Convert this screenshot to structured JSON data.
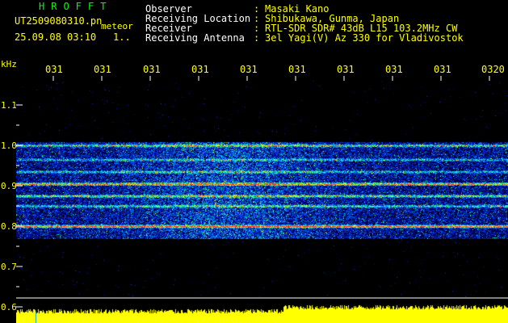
{
  "header": {
    "app_name": "HROFFT",
    "file_name": "UT2509080310.pn",
    "file_kind": "meteor",
    "date_time": "25.09.08 03:10",
    "date_extra": "1..",
    "fields": [
      {
        "label": "Observer",
        "value": "Masaki Kano"
      },
      {
        "label": "Receiving Location",
        "value": "Shibukawa, Gunma, Japan"
      },
      {
        "label": "Receiver",
        "value": "RTL-SDR SDR# 43dB L15 103.2MHz CW"
      },
      {
        "label": "Receiving Antenna",
        "value": "3el Yagi(V) Az 330 for Vladivostok"
      }
    ],
    "separator": ":"
  },
  "chart_data": {
    "type": "heatmap",
    "ylabel": "kHz",
    "y_ticks": [
      "1.1",
      "1.0",
      "0.9",
      "0.8",
      "0.7",
      "0.6"
    ],
    "ylim": [
      0.6,
      1.1
    ],
    "x_ticks": [
      "031",
      "031",
      "031",
      "031",
      "031",
      "031",
      "031",
      "031",
      "031",
      "0320"
    ],
    "signal_band_khz": [
      0.77,
      1.01
    ],
    "carrier_lines_khz": [
      0.8,
      0.85,
      0.875,
      0.905,
      0.935,
      0.965,
      1.0
    ]
  },
  "colors": {
    "background": "#000000",
    "title": "#00ff00",
    "text": "#ffff00",
    "label": "#ffffff",
    "axis": "#ffffff",
    "meter": "#ffff00"
  }
}
